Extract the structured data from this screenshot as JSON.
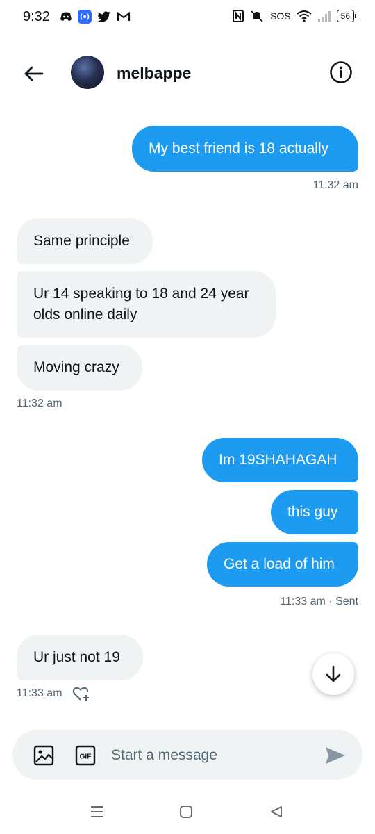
{
  "status_bar": {
    "time": "9:32",
    "sos": "SOS",
    "battery": "56"
  },
  "header": {
    "username": "melbappe"
  },
  "messages": [
    {
      "direction": "out",
      "text": "My best friend is 18 actually"
    },
    {
      "direction": "meta_out",
      "text": "11:32 am"
    },
    {
      "direction": "in",
      "text": "Same principle"
    },
    {
      "direction": "in",
      "text": "Ur 14 speaking to 18 and 24 year olds online daily"
    },
    {
      "direction": "in",
      "text": "Moving crazy"
    },
    {
      "direction": "meta_in",
      "text": "11:32 am"
    },
    {
      "direction": "out",
      "text": "Im 19SHAHAGAH"
    },
    {
      "direction": "out",
      "text": "this guy"
    },
    {
      "direction": "out",
      "text": "Get a load of him"
    },
    {
      "direction": "meta_out",
      "text": "11:33 am · Sent"
    },
    {
      "direction": "in",
      "text": "Ur just not 19"
    },
    {
      "direction": "meta_in",
      "text": "11:33 am"
    }
  ],
  "composer": {
    "placeholder": "Start a message",
    "gif_label": "GIF"
  },
  "colors": {
    "accent": "#1d9bf0",
    "incoming_bg": "#eff3f4",
    "meta_text": "#536471"
  },
  "icons": [
    "back-arrow-icon",
    "info-icon",
    "arrow-down-icon",
    "image-icon",
    "gif-icon",
    "send-icon",
    "heart-plus-icon"
  ]
}
